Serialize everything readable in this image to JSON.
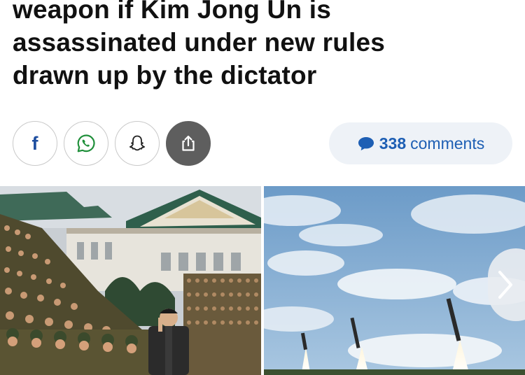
{
  "article": {
    "headline_lines": [
      "weapon if Kim Jong Un is",
      "assassinated under new rules",
      "drawn up by the dictator"
    ]
  },
  "share": {
    "buttons": [
      {
        "icon": "facebook-icon",
        "glyph": "f"
      },
      {
        "icon": "whatsapp-icon"
      },
      {
        "icon": "snapchat-icon"
      },
      {
        "icon": "share-icon"
      }
    ],
    "comments": {
      "count": "338",
      "label": "comments",
      "icon": "comment-bubble-icon",
      "color": "#1e5fb4"
    }
  },
  "gallery": {
    "images": [
      "crowd-photo",
      "rocket-launch-photo"
    ],
    "next_icon": "chevron-right-icon"
  }
}
